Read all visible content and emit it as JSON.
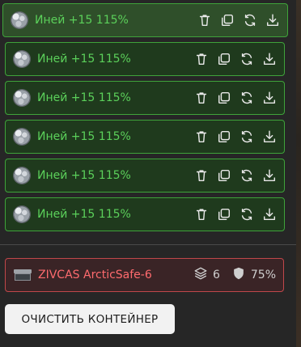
{
  "items": [
    {
      "label": "Иней +15 115%",
      "icon": "ice-ore-icon",
      "active": true
    },
    {
      "label": "Иней +15 115%",
      "icon": "ice-ore-icon",
      "active": false
    },
    {
      "label": "Иней +15 115%",
      "icon": "ice-ore-icon",
      "active": false
    },
    {
      "label": "Иней +15 115%",
      "icon": "ice-ore-icon",
      "active": false
    },
    {
      "label": "Иней +15 115%",
      "icon": "ice-ore-icon",
      "active": false
    },
    {
      "label": "Иней +15 115%",
      "icon": "ice-ore-icon",
      "active": false
    }
  ],
  "item_actions": [
    "trash-icon",
    "copy-icon",
    "refresh-icon",
    "download-icon"
  ],
  "container": {
    "name": "ZIVCAS ArcticSafe-6",
    "slots": "6",
    "protection": "75%",
    "border_color": "#c0474a",
    "name_color": "#ff6b6e"
  },
  "clear_button": {
    "label": "ОЧИСТИТЬ КОНТЕЙНЕР"
  },
  "colors": {
    "item_border": "#3fa33a",
    "item_text": "#5bd05a",
    "background": "#262626"
  }
}
